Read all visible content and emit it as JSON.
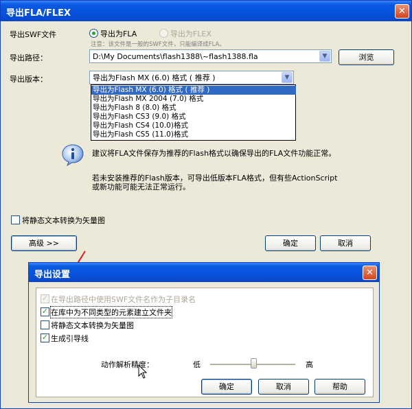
{
  "window": {
    "title": "导出FLA/FLEX",
    "close_label": "✕"
  },
  "export_swf": {
    "label": "导出SWF文件",
    "option_fla": "导出为FLA",
    "option_flex": "导出为FLEX",
    "note": "注意：该文件是一般的SWF文件，只能编译成FLA。"
  },
  "export_path": {
    "label": "导出路径：",
    "value": "D:\\My Documents\\flash1388\\~flash1388.fla",
    "browse_label": "浏览"
  },
  "export_version": {
    "label": "导出版本：",
    "selected": "导出为Flash MX (6.0) 格式 ( 推荐 )",
    "options": [
      "导出为Flash MX (6.0) 格式 ( 推荐 )",
      "导出为Flash MX 2004 (7.0) 格式",
      "导出为Flash 8 (8.0) 格式",
      "导出为Flash CS3 (9.0) 格式",
      "导出为Flash CS4 (10.0)格式",
      "导出为Flash CS5 (11.0)格式"
    ]
  },
  "info": {
    "icon": "info-icon",
    "line1": "建议将FLA文件保存为推荐的Flash格式以确保导出的FLA文件功能正常。",
    "line2": "若未安装推荐的Flash版本，可导出低版本FLA格式，但有些ActionScript",
    "line3": "或新功能可能无法正常运行。"
  },
  "convert_static": {
    "label": "将静态文本转换为矢量图",
    "checked": false
  },
  "buttons": {
    "advanced": "高级 >>",
    "ok": "确定",
    "cancel": "取消"
  },
  "export_settings": {
    "title": "导出设置",
    "close_label": "✕",
    "options": [
      {
        "label": "在导出路径中使用SWF文件名作为子目录名",
        "checked": true,
        "disabled": true
      },
      {
        "label": "在库中为不同类型的元素建立文件夹",
        "checked": true,
        "disabled": false
      },
      {
        "label": "将静态文本转换为矢量图",
        "checked": false,
        "disabled": false
      },
      {
        "label": "生成引导线",
        "checked": true,
        "disabled": false
      }
    ],
    "precision_label": "动作解析精度：",
    "low": "低",
    "high": "高",
    "ok": "确定",
    "cancel": "取消",
    "help": "帮助"
  },
  "colors": {
    "titlebar": "#0a5ae3",
    "dialog_bg": "#ece9d8",
    "selection": "#316ac5",
    "arrow": "#e8151d"
  }
}
